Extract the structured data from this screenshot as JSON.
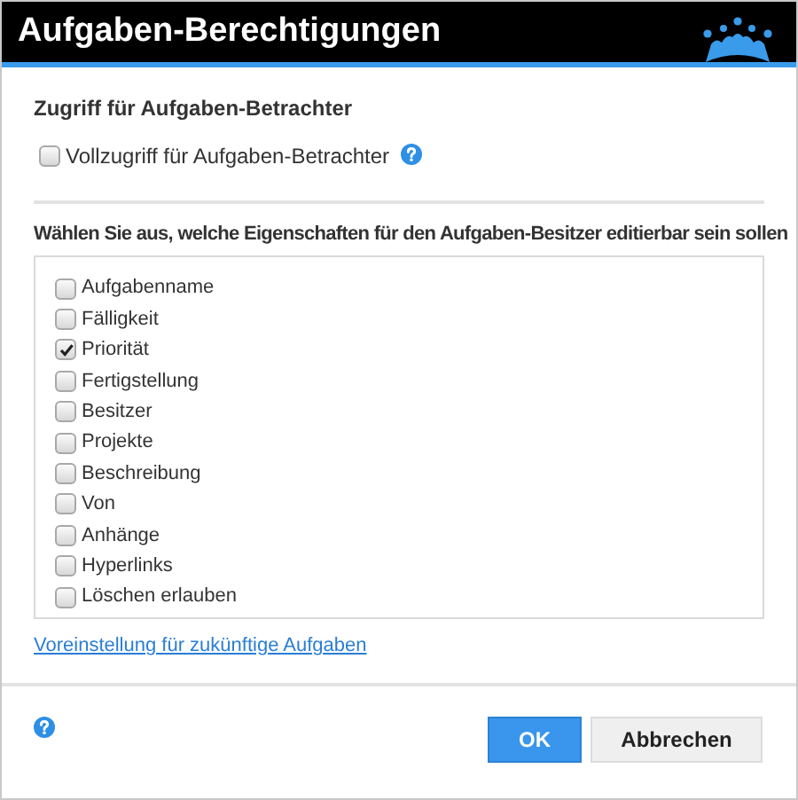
{
  "window": {
    "title": "Aufgaben-Berechtigungen"
  },
  "viewer_section": {
    "heading": "Zugriff für Aufgaben-Betrachter",
    "option": {
      "label": "Vollzugriff für Aufgaben-Betrachter",
      "checked": false
    }
  },
  "owner_section": {
    "heading": "Wählen Sie aus, welche Eigenschaften für den Aufgaben-Besitzer editierbar sein sollen",
    "options": [
      {
        "label": "Aufgabenname",
        "checked": false
      },
      {
        "label": "Fälligkeit",
        "checked": false
      },
      {
        "label": "Priorität",
        "checked": true
      },
      {
        "label": "Fertigstellung",
        "checked": false
      },
      {
        "label": "Besitzer",
        "checked": false
      },
      {
        "label": "Projekte",
        "checked": false
      },
      {
        "label": "Beschreibung",
        "checked": false
      },
      {
        "label": "Von",
        "checked": false
      },
      {
        "label": "Anhänge",
        "checked": false
      },
      {
        "label": "Hyperlinks",
        "checked": false
      },
      {
        "label": "Löschen erlauben",
        "checked": false
      }
    ]
  },
  "default_link": "Voreinstellung für zukünftige Aufgaben",
  "buttons": {
    "ok": "OK",
    "cancel": "Abbrechen"
  }
}
